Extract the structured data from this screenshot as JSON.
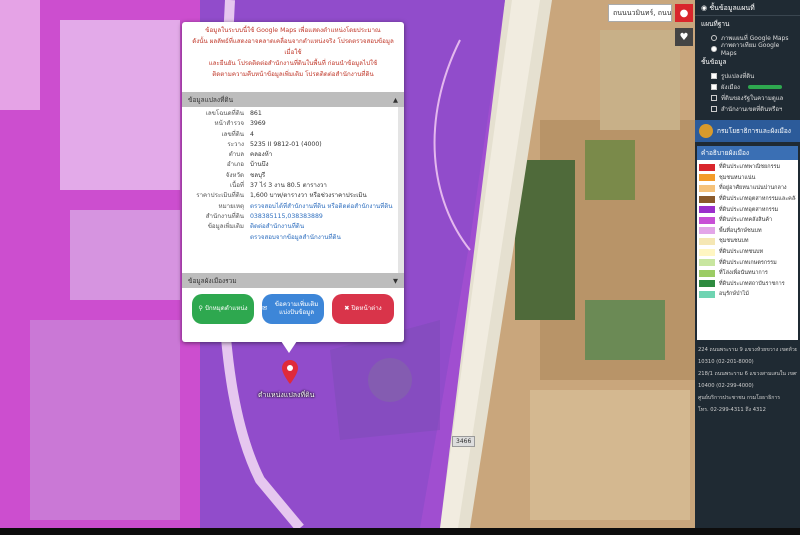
{
  "search": {
    "value": "ถนนนวมินทร์, ถนน"
  },
  "popup": {
    "warning_lines": [
      "ข้อมูลในระบบนี้ใช้ Google Maps เพื่อแสดงตำแหน่งโดยประมาณ",
      "ดังนั้น ผลลัพธ์ที่แสดงอาจคลาดเคลื่อนจากตำแหน่งจริง โปรดตรวจสอบข้อมูล เมื่อใช้",
      "และยืนยัน โปรดติดต่อสำนักงานที่ดินในพื้นที่ ก่อนนำข้อมูลไปใช้",
      "ติดตามความคืบหน้าข้อมูลเพิ่มเติม โปรดติดต่อสำนักงานที่ดิน"
    ],
    "section_title": "ข้อมูลแปลงที่ดิน",
    "section_title_2": "ข้อมูลผังเมืองรวม",
    "rows": [
      {
        "k": "เลขโฉนดที่ดิน",
        "v": "861"
      },
      {
        "k": "หน้าสำรวจ",
        "v": "3969"
      },
      {
        "k": "เลขที่ดิน",
        "v": "4"
      },
      {
        "k": "ระวาง",
        "v": "5235 II 9812-01 (4000)"
      },
      {
        "k": "ตำบล",
        "v": "คลองห้า"
      },
      {
        "k": "อำเภอ",
        "v": "บ้านบึง"
      },
      {
        "k": "จังหวัด",
        "v": "ชลบุรี"
      },
      {
        "k": "เนื้อที่",
        "v": "37 ไร่ 3 งาน 80.5 ตารางวา"
      },
      {
        "k": "ราคาประเมินที่ดิน",
        "v": "1,600 บาท/ตารางวา หรือช่วงราคาประเมิน"
      },
      {
        "k": "หมายเหตุ",
        "v": "ตรวจสอบได้ที่สำนักงานที่ดิน หรือติดต่อสำนักงานที่ดิน",
        "link": true
      },
      {
        "k": "สำนักงานที่ดิน",
        "v": "038385115,038383889",
        "link": true
      },
      {
        "k": "ข้อมูลเพิ่มเติม",
        "v": "ติดต่อสำนักงานที่ดิน",
        "link": true
      },
      {
        "k": "",
        "v": "ตรวจสอบจากข้อมูลสำนักงานที่ดิน",
        "link": true
      }
    ],
    "buttons": {
      "location": "ปักหมุดตำแหน่ง",
      "share": "ข้อความเพิ่มเติม แบ่งปันข้อมูล",
      "close": "ปิดหน้าต่าง"
    }
  },
  "marker_label": "ตำแหน่งแปลงที่ดิน",
  "road_label": "3466",
  "panel": {
    "title": "ชั้นข้อมูลแผนที่",
    "basemap_title": "แผนที่ฐาน",
    "basemap_options": [
      "ภาพแผนที่ Google Maps",
      "ภาพดาวเทียม Google Maps"
    ],
    "layer_title": "ชั้นข้อมูล",
    "layer_options": [
      "รูปแปลงที่ดิน",
      "ผังเมือง",
      "ที่ดินของรัฐในความดูแล",
      "สำนักงานเขตที่ดินหรือฯ"
    ],
    "org_name": "กรมโยธาธิการและผังเมือง",
    "legend_title": "คำอธิบายผังเมือง",
    "legend": [
      {
        "label": "ที่ดินประเภทพาณิชยกรรม",
        "color": "#d9262c"
      },
      {
        "label": "ชุมชนหนาแน่น",
        "color": "#f39c2a"
      },
      {
        "label": "ที่อยู่อาศัยหนาแน่นปานกลาง",
        "color": "#f5c27a"
      },
      {
        "label": "ที่ดินประเภทอุตสาหกรรมและคลังสินค้า",
        "color": "#8a5a2b"
      },
      {
        "label": "ที่ดินประเภทอุตสาหกรรม",
        "color": "#9b2fcb"
      },
      {
        "label": "ที่ดินประเภทคลังสินค้า",
        "color": "#c84fd6"
      },
      {
        "label": "พื้นที่อนุรักษ์ชนบท",
        "color": "#e3a6e8"
      },
      {
        "label": "ชุมชนชนบท",
        "color": "#f5e7b4"
      },
      {
        "label": "ที่ดินประเภทชนบท",
        "color": "#fff6c2"
      },
      {
        "label": "ที่ดินประเภทเกษตรกรรม",
        "color": "#c8e6a0"
      },
      {
        "label": "ที่โล่งเพื่อนันทนาการ",
        "color": "#9ccc65"
      },
      {
        "label": "ที่ดินประเภทสถาบันราชการ",
        "color": "#2e8b3f"
      },
      {
        "label": "อนุรักษ์ป่าไม้",
        "color": "#6fd4b2"
      }
    ],
    "contacts": [
      "224 ถนนพระราม 9 แขวงห้วยขวาง เขตห้วยขวาง",
      "10310 (02-201-8000)",
      "218/1 ถนนพระราม 6 แขวงสามเสนใน เขตพญาไท",
      "10400 (02-299-4000)",
      "ศูนย์บริการประชาชน กรมโยธาธิการ",
      "โทร. 02-299-4311 ถึง 4312"
    ]
  },
  "colors": {
    "zone_purple": "#b24fd6",
    "zone_magenta": "#d94fd6",
    "panel_bg": "#1f2a33"
  }
}
